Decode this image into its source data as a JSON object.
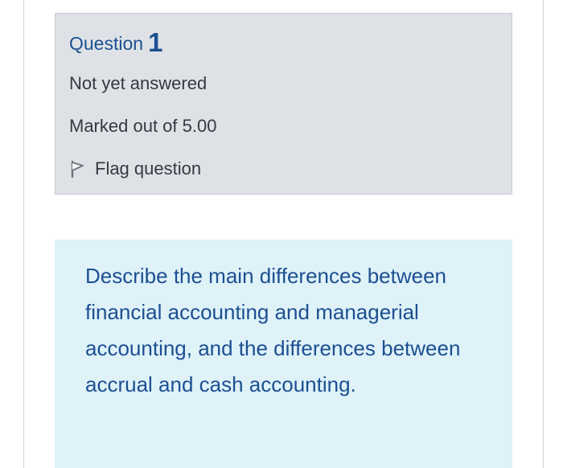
{
  "question": {
    "label": "Question",
    "number": "1",
    "state": "Not yet answered",
    "grade": "Marked out of 5.00",
    "flag_label": "Flag question"
  },
  "question_text": "Describe the main differences between financial accounting and managerial accounting, and the differences between accrual and cash accounting.",
  "icons": {
    "flag": "flag-icon"
  },
  "colors": {
    "info_background": "#dee2e6",
    "content_background": "#def2f8",
    "heading": "#1d4f91",
    "text": "#343a40"
  }
}
